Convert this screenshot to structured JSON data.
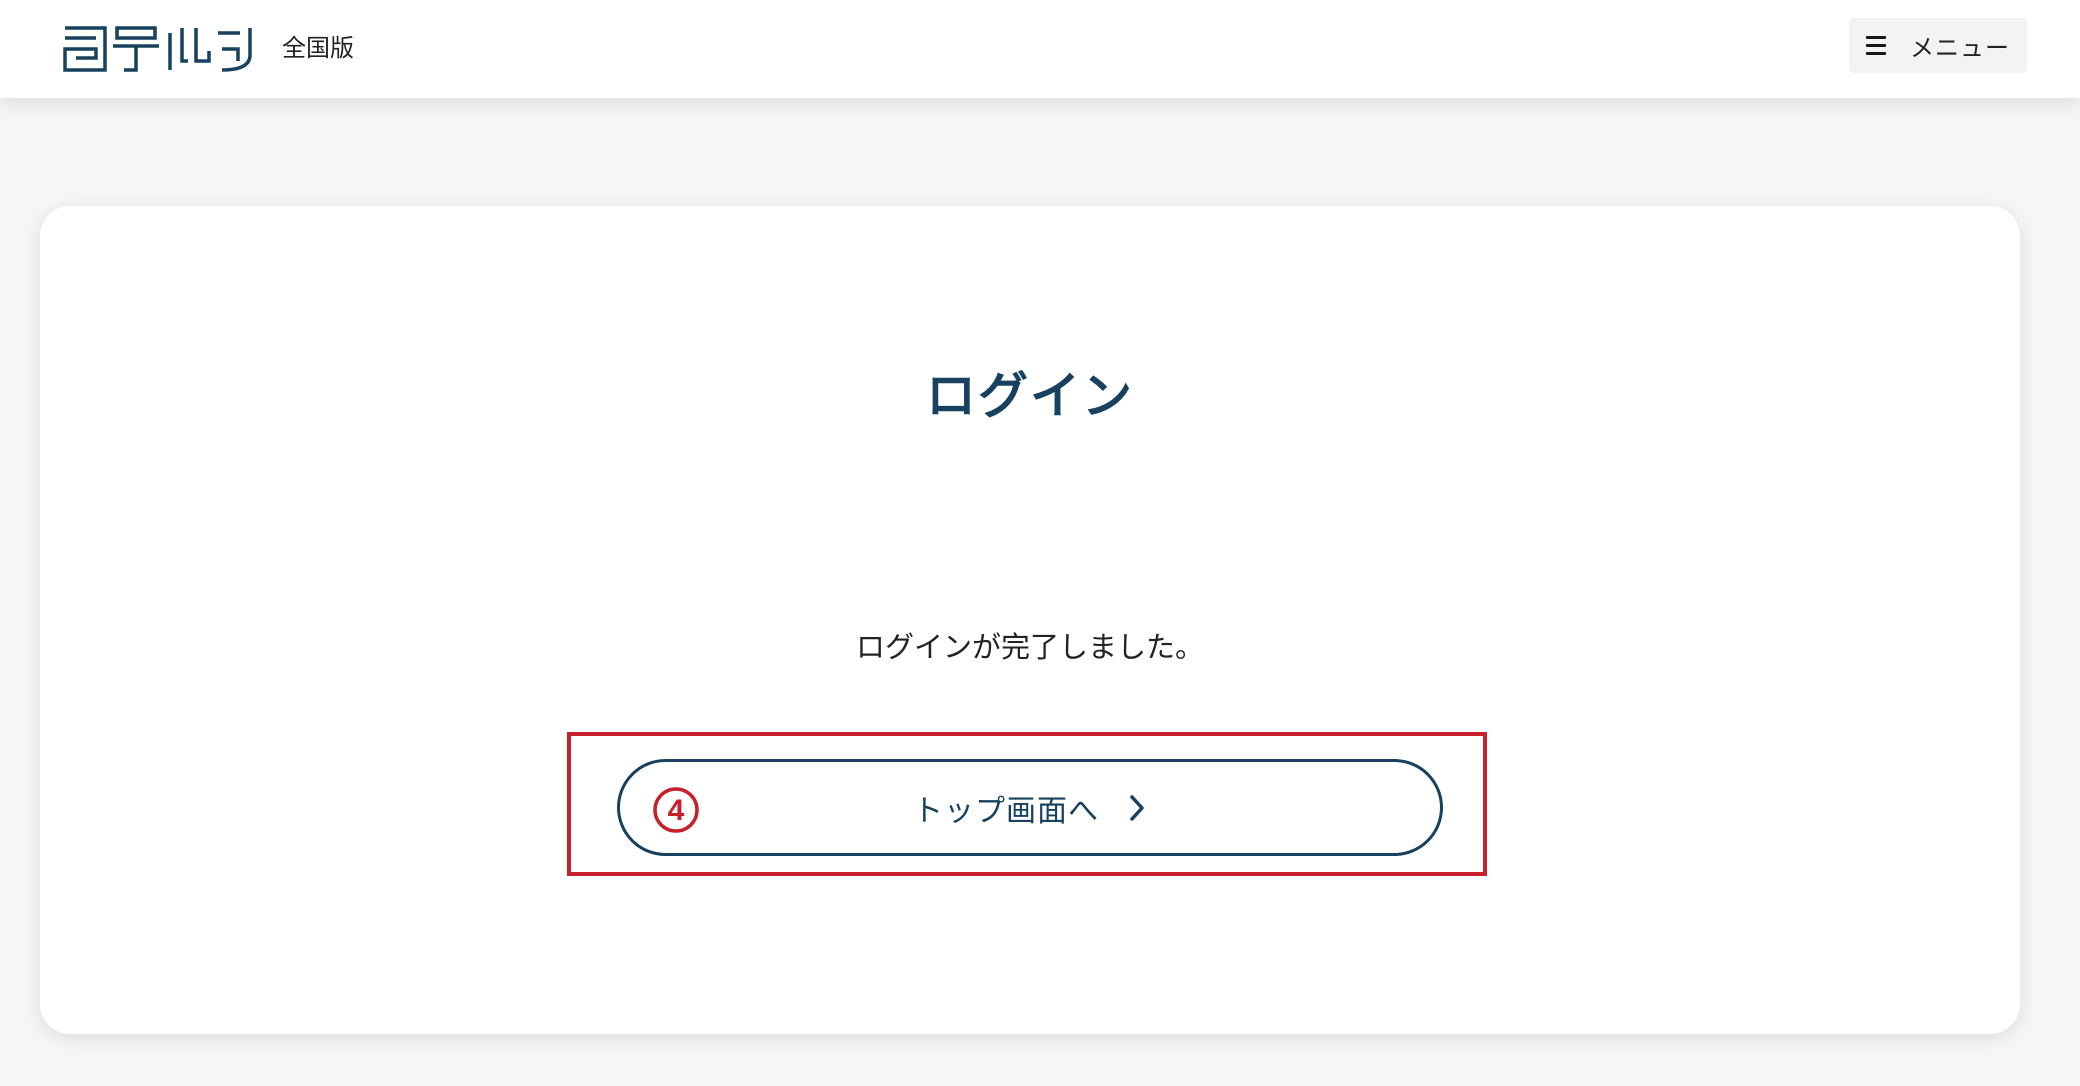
{
  "header": {
    "logo_alt": "タテルン",
    "edition_label": "全国版",
    "menu_label": "メニュー",
    "menu_icon": "hamburger-icon"
  },
  "main": {
    "title": "ログイン",
    "message": "ログインが完了しました。",
    "top_button_label": "トップ画面へ",
    "top_button_icon": "chevron-right-icon",
    "annotation_number": "4"
  },
  "colors": {
    "brand_navy": "#17415f",
    "annotation_red": "#c8202a",
    "header_bg": "#ffffff",
    "page_bg": "#f6f6f6"
  }
}
